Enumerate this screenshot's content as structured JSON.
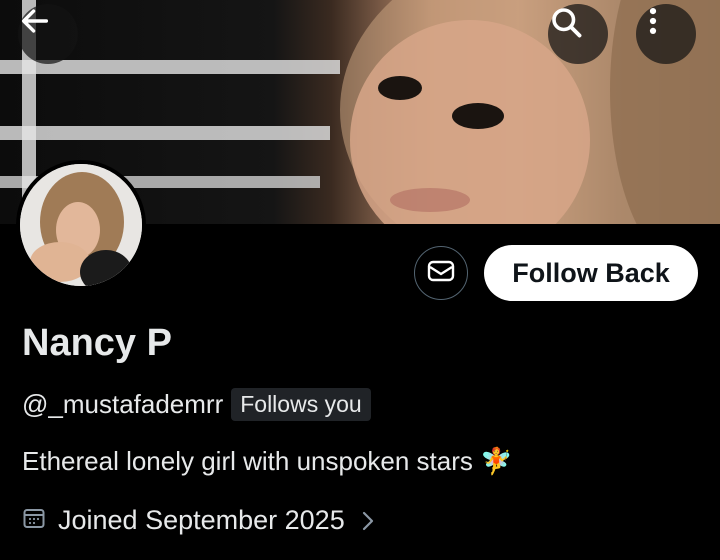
{
  "header": {
    "back_icon": "arrow-left-icon",
    "search_icon": "search-icon",
    "more_icon": "more-vertical-icon"
  },
  "profile": {
    "display_name": "Nancy P",
    "handle": "@_mustafademrr",
    "follows_you_badge": "Follows you",
    "bio": "Ethereal lonely girl with unspoken stars 🧚",
    "joined": "Joined September 2025"
  },
  "actions": {
    "message_icon": "envelope-icon",
    "follow_back_label": "Follow Back"
  },
  "colors": {
    "background": "#000000",
    "text": "#e7e9ea",
    "button_bg": "#ffffff",
    "button_text": "#0f1419",
    "border": "#536471",
    "badge_bg": "#202327"
  }
}
